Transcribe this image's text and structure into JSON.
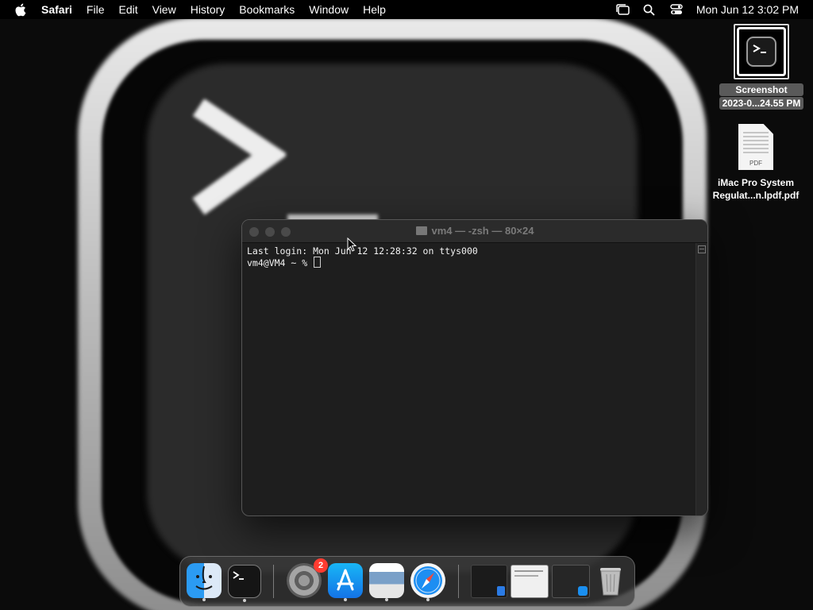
{
  "menubar": {
    "apple_icon": "apple-icon",
    "app_name": "Safari",
    "menus": [
      "File",
      "Edit",
      "View",
      "History",
      "Bookmarks",
      "Window",
      "Help"
    ],
    "status_icons": [
      "stage-manager-icon",
      "spotlight-search-icon",
      "control-center-icon"
    ],
    "clock": "Mon Jun 12  3:02 PM"
  },
  "desktop": {
    "screenshot": {
      "line1": "Screenshot",
      "line2": "2023-0...24.55 PM"
    },
    "pdf": {
      "line1": "iMac Pro System",
      "line2": "Regulat...n.lpdf.pdf",
      "doc_tag": "PDF"
    }
  },
  "terminal": {
    "title": "vm4 — -zsh — 80×24",
    "lines": [
      "Last login: Mon Jun 12 12:28:32 on ttys000"
    ],
    "prompt": "vm4@VM4 ~ % "
  },
  "dock": {
    "notification_badge": "2",
    "apps": [
      "finder",
      "terminal",
      "system-settings",
      "app-store",
      "preview",
      "safari"
    ],
    "windows": [
      "minimized-window-1",
      "minimized-window-2",
      "minimized-window-3"
    ],
    "trash": "trash"
  },
  "colors": {
    "badge": "#ff3b30",
    "menubar": "#000000",
    "terminal_bg": "#1e1e1e"
  }
}
